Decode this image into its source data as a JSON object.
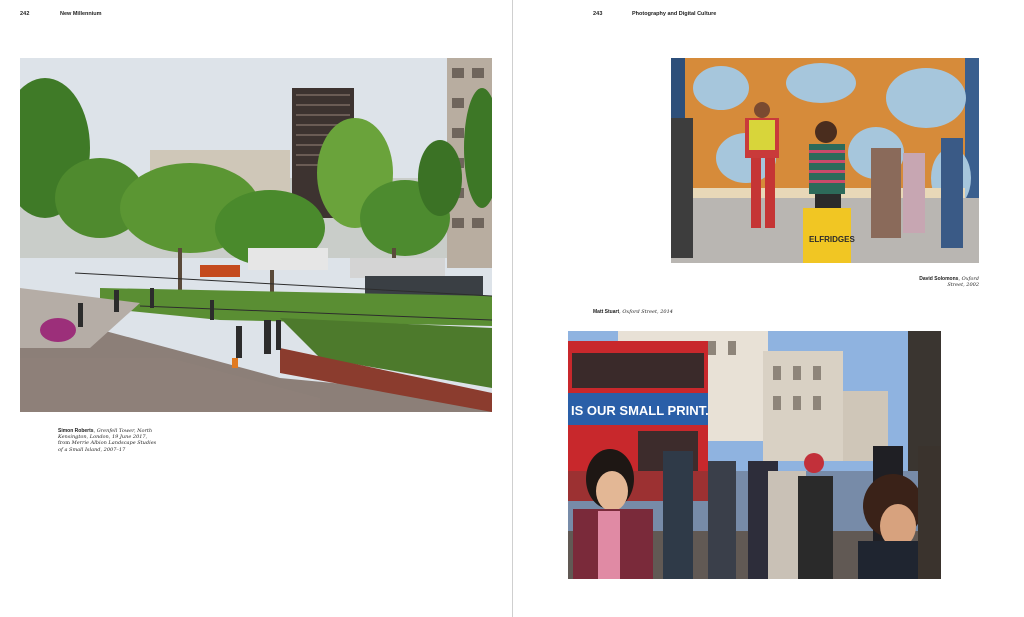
{
  "left_page": {
    "folio": "242",
    "running_head": "New Millennium",
    "caption": {
      "photographer": "Simon Roberts",
      "line1_rest": "Grenfell Tower, North",
      "line2": "Kensington, London, 19 June 2017,",
      "line3_plain": "from",
      "line3_italic": "Merrie Albion Landscape Studies",
      "line4": "of a Small Island, 2007–17"
    }
  },
  "right_page": {
    "folio": "243",
    "running_head": "Photography and Digital Culture",
    "caption_top": {
      "photographer": "David Solomons",
      "line1_rest": "Oxford",
      "line2": "Street, 2002"
    },
    "caption_bottom": {
      "photographer": "Matt Stuart",
      "title": "Oxford Street, 2014"
    },
    "bus_sign": "IS OUR SMALL PRINT.",
    "bag_text": "ELFRIDGES"
  },
  "colors": {
    "sky": "#d9dfe6",
    "tree_green": "#4f8a2e",
    "pavement": "#8c7f78",
    "bus_red": "#c8282c",
    "mural_orange": "#d68b3a",
    "mural_blue": "#a6c6dc",
    "bag_yellow": "#f1c623"
  }
}
